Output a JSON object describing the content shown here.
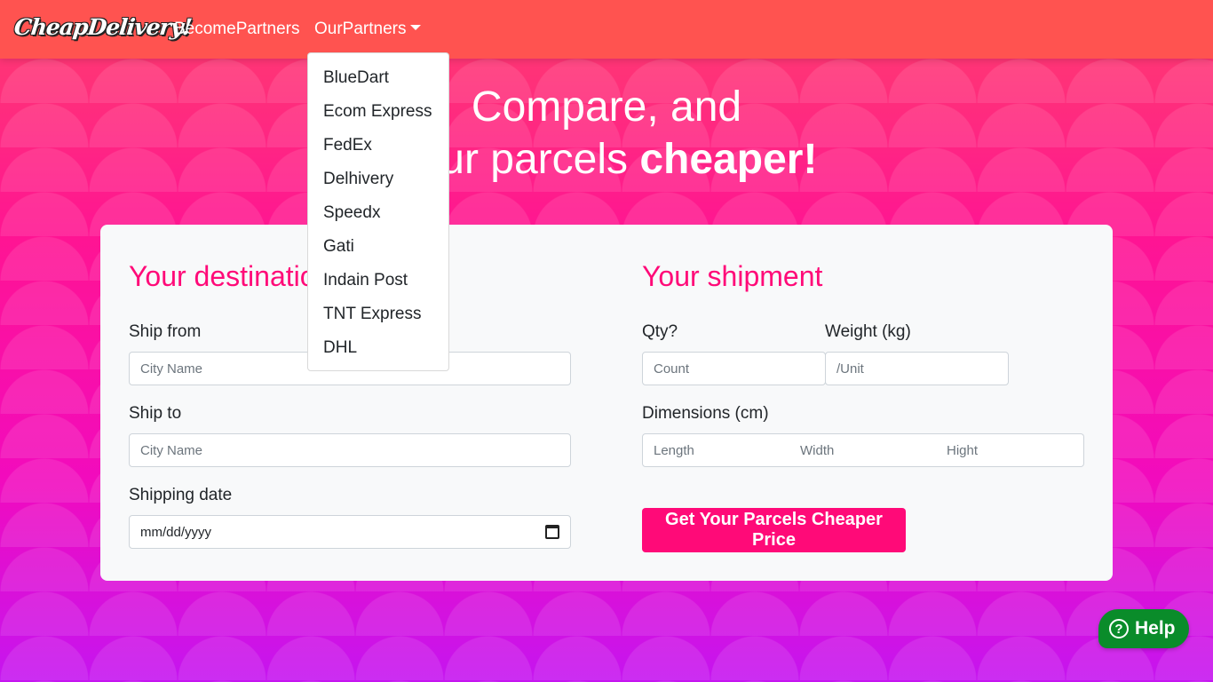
{
  "navbar": {
    "brand": "CheapDelivery!",
    "become_partners": "BecomePartners",
    "our_partners": "OurPartners",
    "partners_dropdown": [
      "BlueDart",
      "Ecom Express",
      "FedEx",
      "Delhivery",
      "Speedx",
      "Gati",
      "Indain Post",
      "TNT Express",
      "DHL"
    ]
  },
  "hero": {
    "line1": "Compare, and",
    "line2_prefix": "your parcels ",
    "line2_bold": "cheaper!"
  },
  "destination": {
    "title": "Your destinatio",
    "ship_from_label": "Ship from",
    "ship_from_placeholder": "City Name",
    "ship_to_label": "Ship to",
    "ship_to_placeholder": "City Name",
    "date_label": "Shipping date",
    "date_value": "mm/dd/yyyy"
  },
  "shipment": {
    "title": "Your shipment",
    "qty_label": "Qty?",
    "qty_placeholder": "Count",
    "weight_label": "Weight (kg)",
    "weight_placeholder": "/Unit",
    "dimensions_label": "Dimensions (cm)",
    "length_placeholder": "Length",
    "width_placeholder": "Width",
    "height_placeholder": "Hight",
    "submit_label": "Get Your Parcels Cheaper Price"
  },
  "help": {
    "icon": "question-circle-icon",
    "label": "Help"
  },
  "colors": {
    "navbar": "#ff5350",
    "accent": "#ff0a78",
    "help": "#0a8c2a"
  }
}
